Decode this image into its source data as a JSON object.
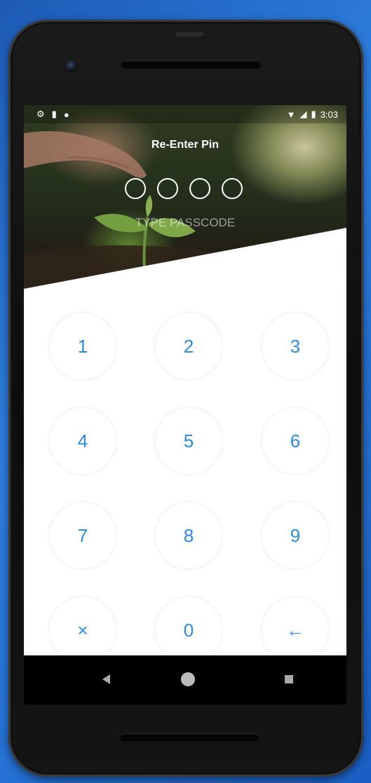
{
  "status": {
    "time": "3:03",
    "left_icons": [
      "settings-icon",
      "lock-icon",
      "circle-icon"
    ],
    "right_icons": [
      "wifi-icon",
      "signal-icon",
      "battery-icon"
    ]
  },
  "header": {
    "title": "Re-Enter Pin",
    "subtitle": "TYPE PASSCODE",
    "pin_length": 4
  },
  "keypad": {
    "keys": [
      "1",
      "2",
      "3",
      "4",
      "5",
      "6",
      "7",
      "8",
      "9",
      "×",
      "0",
      "←"
    ]
  },
  "colors": {
    "accent": "#2c8ce0",
    "background": "#ffffff"
  },
  "navbar": {
    "icons": [
      "back-icon",
      "home-icon",
      "recents-icon"
    ]
  }
}
